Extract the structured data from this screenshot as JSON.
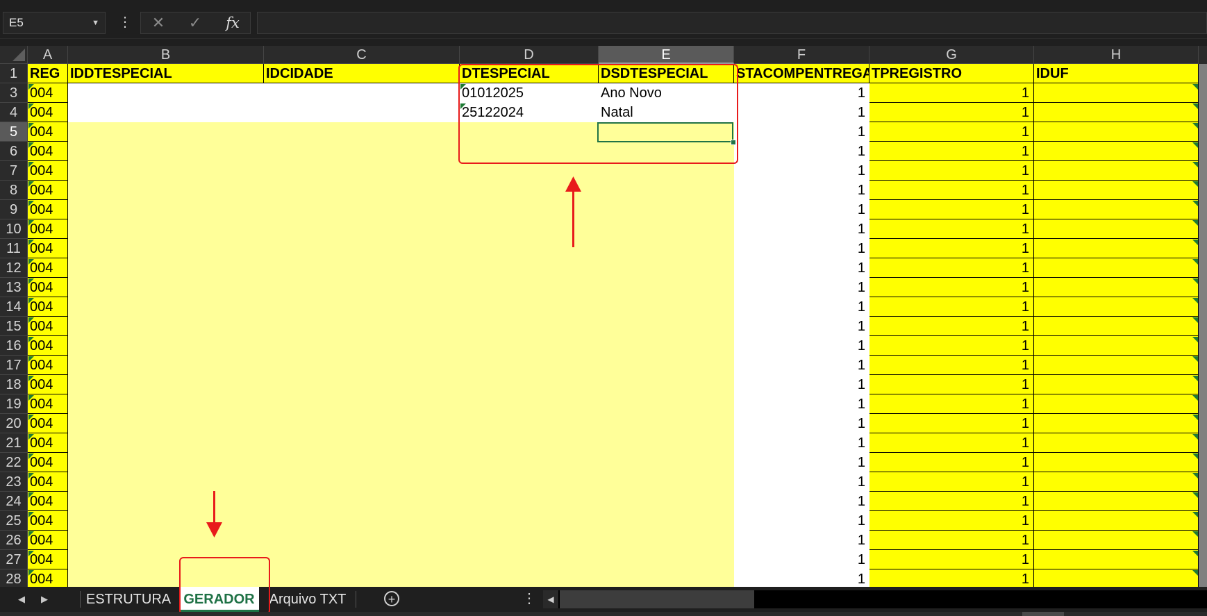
{
  "formula_bar": {
    "name_box": "E5",
    "more_glyph": "⋮",
    "cancel_glyph": "✕",
    "enter_glyph": "✓",
    "fx_label": "fx",
    "formula": ""
  },
  "columns": [
    "A",
    "B",
    "C",
    "D",
    "E",
    "F",
    "G",
    "H"
  ],
  "selected_column": "E",
  "header_row": {
    "row_number": "1",
    "cells": [
      "REG",
      "IDDTESPECIAL",
      "IDCIDADE",
      "DTESPECIAL",
      "DSDTESPECIAL",
      "STACOMPENTREGA",
      "TPREGISTRO",
      "IDUF"
    ]
  },
  "data_rows": [
    {
      "row": "3",
      "A": "004",
      "D": "01012025",
      "E": "Ano Novo",
      "F": "1",
      "G": "1"
    },
    {
      "row": "4",
      "A": "004",
      "D": "25122024",
      "E": "Natal",
      "F": "1",
      "G": "1"
    },
    {
      "row": "5",
      "A": "004",
      "D": "",
      "E": "",
      "F": "1",
      "G": "1"
    },
    {
      "row": "6",
      "A": "004",
      "D": "",
      "E": "",
      "F": "1",
      "G": "1"
    },
    {
      "row": "7",
      "A": "004",
      "D": "",
      "E": "",
      "F": "1",
      "G": "1"
    },
    {
      "row": "8",
      "A": "004",
      "D": "",
      "E": "",
      "F": "1",
      "G": "1"
    },
    {
      "row": "9",
      "A": "004",
      "D": "",
      "E": "",
      "F": "1",
      "G": "1"
    },
    {
      "row": "10",
      "A": "004",
      "D": "",
      "E": "",
      "F": "1",
      "G": "1"
    },
    {
      "row": "11",
      "A": "004",
      "D": "",
      "E": "",
      "F": "1",
      "G": "1"
    },
    {
      "row": "12",
      "A": "004",
      "D": "",
      "E": "",
      "F": "1",
      "G": "1"
    },
    {
      "row": "13",
      "A": "004",
      "D": "",
      "E": "",
      "F": "1",
      "G": "1"
    },
    {
      "row": "14",
      "A": "004",
      "D": "",
      "E": "",
      "F": "1",
      "G": "1"
    },
    {
      "row": "15",
      "A": "004",
      "D": "",
      "E": "",
      "F": "1",
      "G": "1"
    },
    {
      "row": "16",
      "A": "004",
      "D": "",
      "E": "",
      "F": "1",
      "G": "1"
    },
    {
      "row": "17",
      "A": "004",
      "D": "",
      "E": "",
      "F": "1",
      "G": "1"
    },
    {
      "row": "18",
      "A": "004",
      "D": "",
      "E": "",
      "F": "1",
      "G": "1"
    },
    {
      "row": "19",
      "A": "004",
      "D": "",
      "E": "",
      "F": "1",
      "G": "1"
    },
    {
      "row": "20",
      "A": "004",
      "D": "",
      "E": "",
      "F": "1",
      "G": "1"
    },
    {
      "row": "21",
      "A": "004",
      "D": "",
      "E": "",
      "F": "1",
      "G": "1"
    },
    {
      "row": "22",
      "A": "004",
      "D": "",
      "E": "",
      "F": "1",
      "G": "1"
    },
    {
      "row": "23",
      "A": "004",
      "D": "",
      "E": "",
      "F": "1",
      "G": "1"
    },
    {
      "row": "24",
      "A": "004",
      "D": "",
      "E": "",
      "F": "1",
      "G": "1"
    },
    {
      "row": "25",
      "A": "004",
      "D": "",
      "E": "",
      "F": "1",
      "G": "1"
    },
    {
      "row": "26",
      "A": "004",
      "D": "",
      "E": "",
      "F": "1",
      "G": "1"
    },
    {
      "row": "27",
      "A": "004",
      "D": "",
      "E": "",
      "F": "1",
      "G": "1"
    },
    {
      "row": "28",
      "A": "004",
      "D": "",
      "E": "",
      "F": "1",
      "G": "1"
    }
  ],
  "selected_row": "5",
  "sheet_tabs": [
    {
      "label": "ESTRUTURA",
      "active": false
    },
    {
      "label": "GERADOR",
      "active": true
    },
    {
      "label": "Arquivo TXT",
      "active": false
    }
  ],
  "tab_nav": {
    "prev": "◀",
    "next": "▶",
    "add": "+",
    "more": "⋮"
  },
  "colors": {
    "header_yellow": "#ffff00",
    "input_light_yellow": "#ffff99",
    "annotation_red": "#e81b1b",
    "excel_green": "#217346"
  }
}
